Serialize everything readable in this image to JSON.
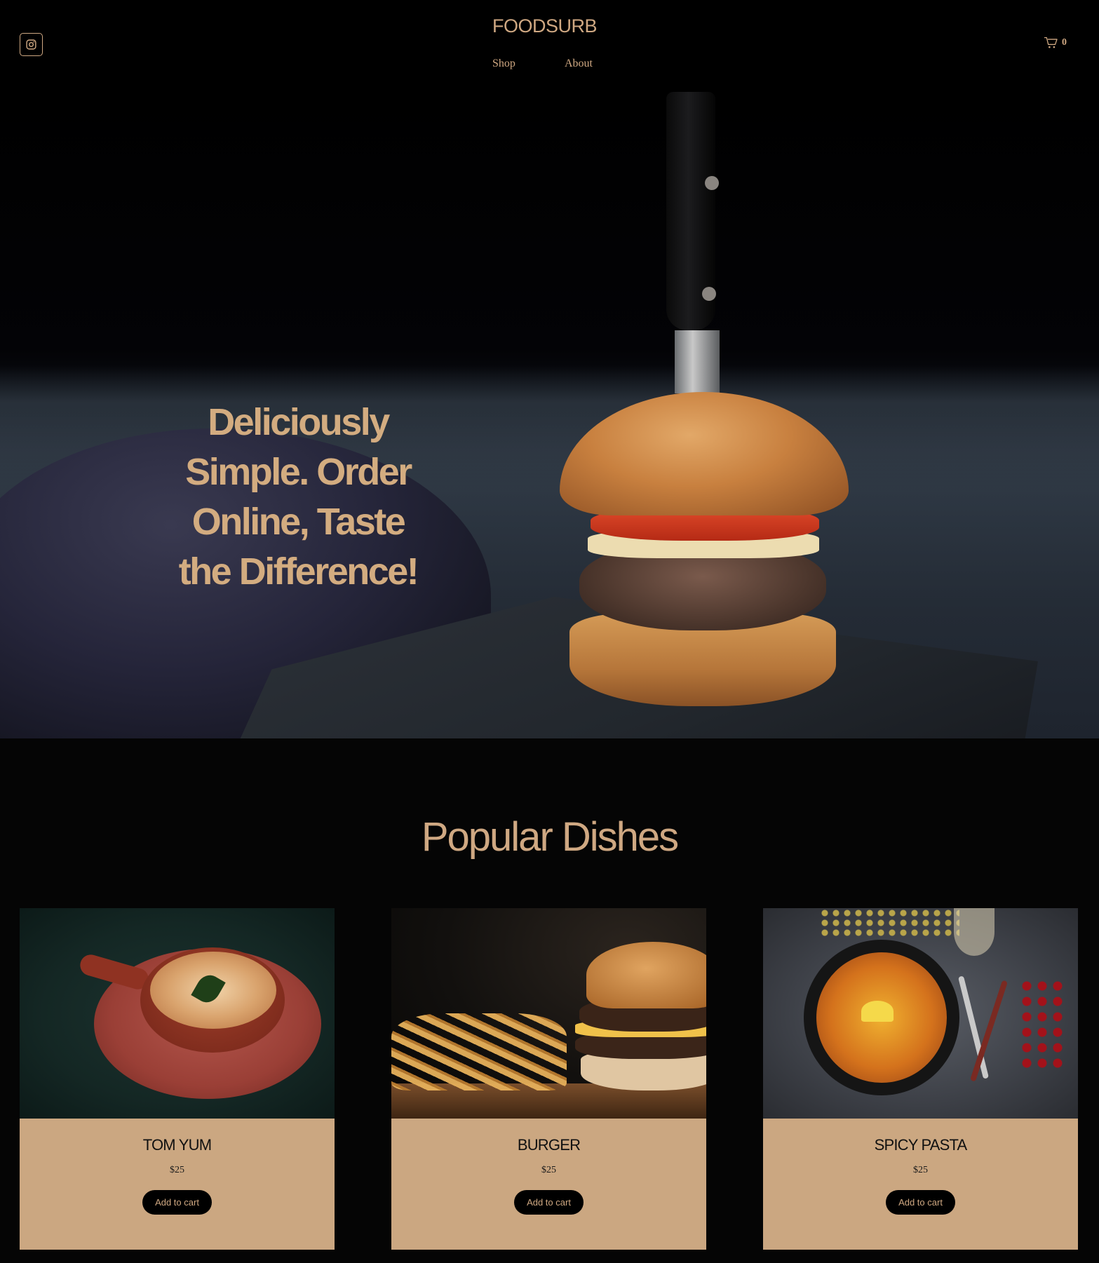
{
  "header": {
    "logo": "FOODSURB",
    "nav": [
      "Shop",
      "About"
    ],
    "cart_count": "0",
    "icons": {
      "instagram": "instagram-icon",
      "cart": "cart-icon"
    }
  },
  "hero": {
    "title_lines": [
      "Deliciously",
      "Simple. Order",
      "Online, Taste",
      "the Difference!"
    ]
  },
  "popular": {
    "title": "Popular Dishes",
    "dishes": [
      {
        "name": "TOM YUM",
        "price": "$25",
        "button": "Add to cart"
      },
      {
        "name": "BURGER",
        "price": "$25",
        "button": "Add to cart"
      },
      {
        "name": "SPICY PASTA",
        "price": "$25",
        "button": "Add to cart"
      }
    ]
  },
  "colors": {
    "background": "#050505",
    "accent": "#cfa882",
    "card_background": "#cba781",
    "button_background": "#000000"
  }
}
